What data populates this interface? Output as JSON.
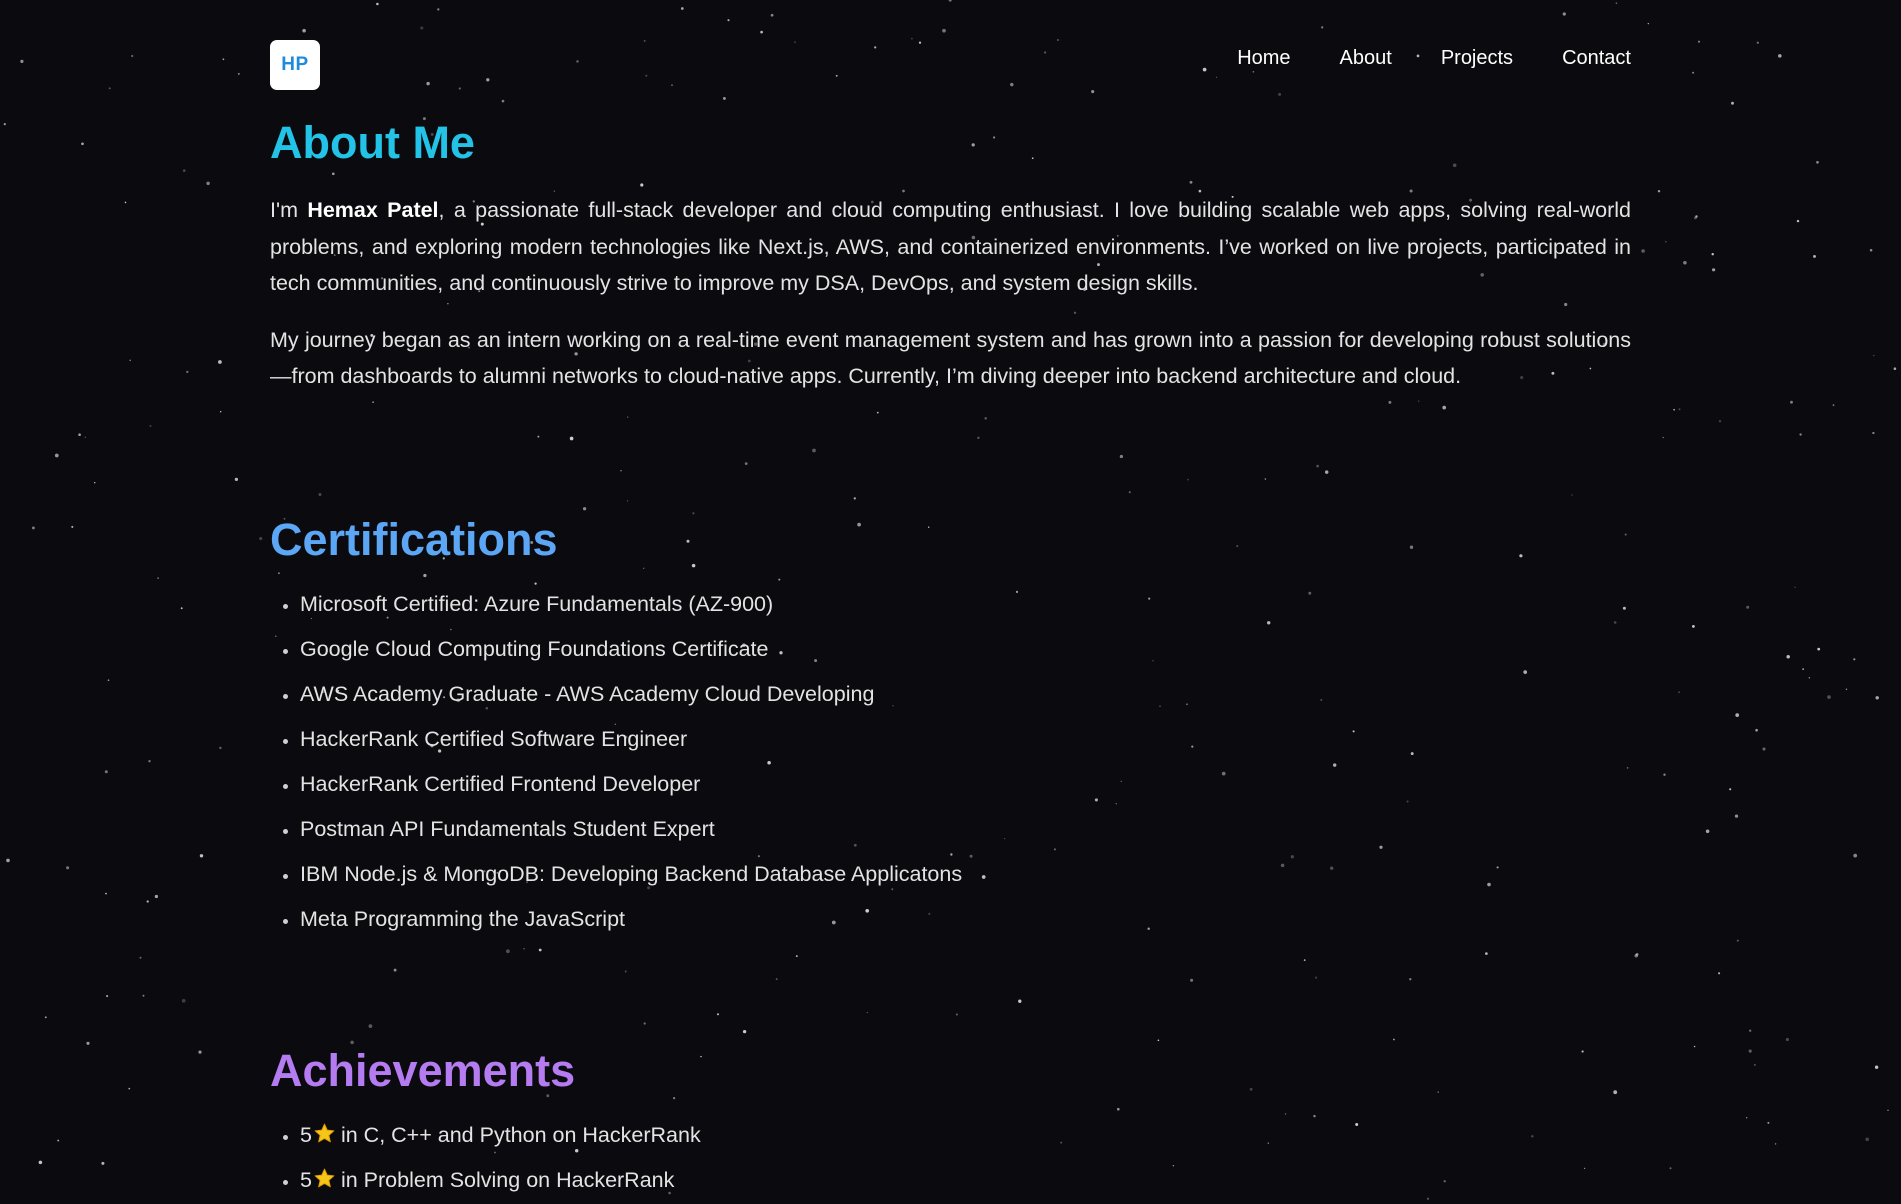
{
  "header": {
    "logo_text": "HP",
    "nav": [
      "Home",
      "About",
      "Projects",
      "Contact"
    ]
  },
  "about": {
    "title": "About Me",
    "p1_intro": "I'm ",
    "p1_name": "Hemax Patel",
    "p1_rest": ", a passionate full-stack developer and cloud computing enthusiast. I love building scalable web apps, solving real-world problems, and exploring modern technologies like Next.js, AWS, and containerized environments. I’ve worked on live projects, participated in tech communities, and continuously strive to improve my DSA, DevOps, and system design skills.",
    "p2": "My journey began as an intern working on a real-time event management system and has grown into a passion for developing robust solutions—from dashboards to alumni networks to cloud-native apps. Currently, I’m diving deeper into backend architecture and cloud."
  },
  "certifications": {
    "title": "Certifications",
    "items": [
      "Microsoft Certified: Azure Fundamentals (AZ-900)",
      "Google Cloud Computing Foundations Certificate",
      "AWS Academy Graduate - AWS Academy Cloud Developing",
      "HackerRank Certified Software Engineer",
      "HackerRank Certified Frontend Developer",
      "Postman API Fundamentals Student Expert",
      "IBM Node.js & MongoDB: Developing Backend Database Applicatons",
      "Meta Programming the JavaScript"
    ]
  },
  "achievements": {
    "title": "Achievements",
    "items": [
      {
        "count": "5",
        "icon": "star-icon",
        "text": "in C, C++ and Python on HackerRank"
      },
      {
        "count": "5",
        "icon": "star-icon",
        "text": "in Problem Solving on HackerRank"
      }
    ]
  },
  "colors": {
    "background": "#0b0b0f",
    "about_title": "#22c3e6",
    "certifications_title": "#5ba6f5",
    "achievements_title": "#b57bf0",
    "logo_text": "#1f8be0",
    "star": "#f5c518"
  }
}
